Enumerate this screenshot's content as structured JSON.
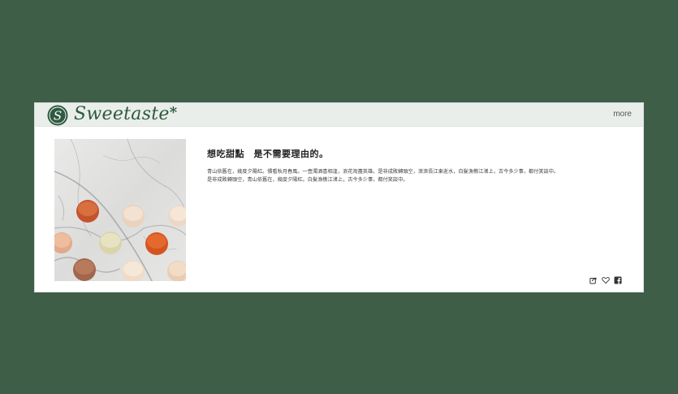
{
  "header": {
    "brand": "Sweetaste",
    "brand_mark": "*",
    "logo_letter": "S",
    "more_label": "more"
  },
  "article": {
    "title": "想吃甜點　是不需要理由的。",
    "paragraphs": [
      "青山依舊在，幾度夕陽紅。慣看秋月春風。一壺濁酒喜相逢，浪花淘盡英雄。是非成敗轉頭空，滾滾長江東逝水，白髮漁樵江渚上，古今多少事，都付笑談中。",
      "是非成敗轉頭空，青山依舊在，幾度夕陽紅。白髮漁樵江渚上，古今多少事，都付笑談中。"
    ]
  },
  "actions": {
    "icons": [
      "share-icon",
      "heart-icon",
      "facebook-icon"
    ]
  },
  "colors": {
    "page_background": "#3e5e47",
    "header_background": "#e9eeea",
    "brand": "#2f5a40",
    "card": "#ffffff"
  }
}
